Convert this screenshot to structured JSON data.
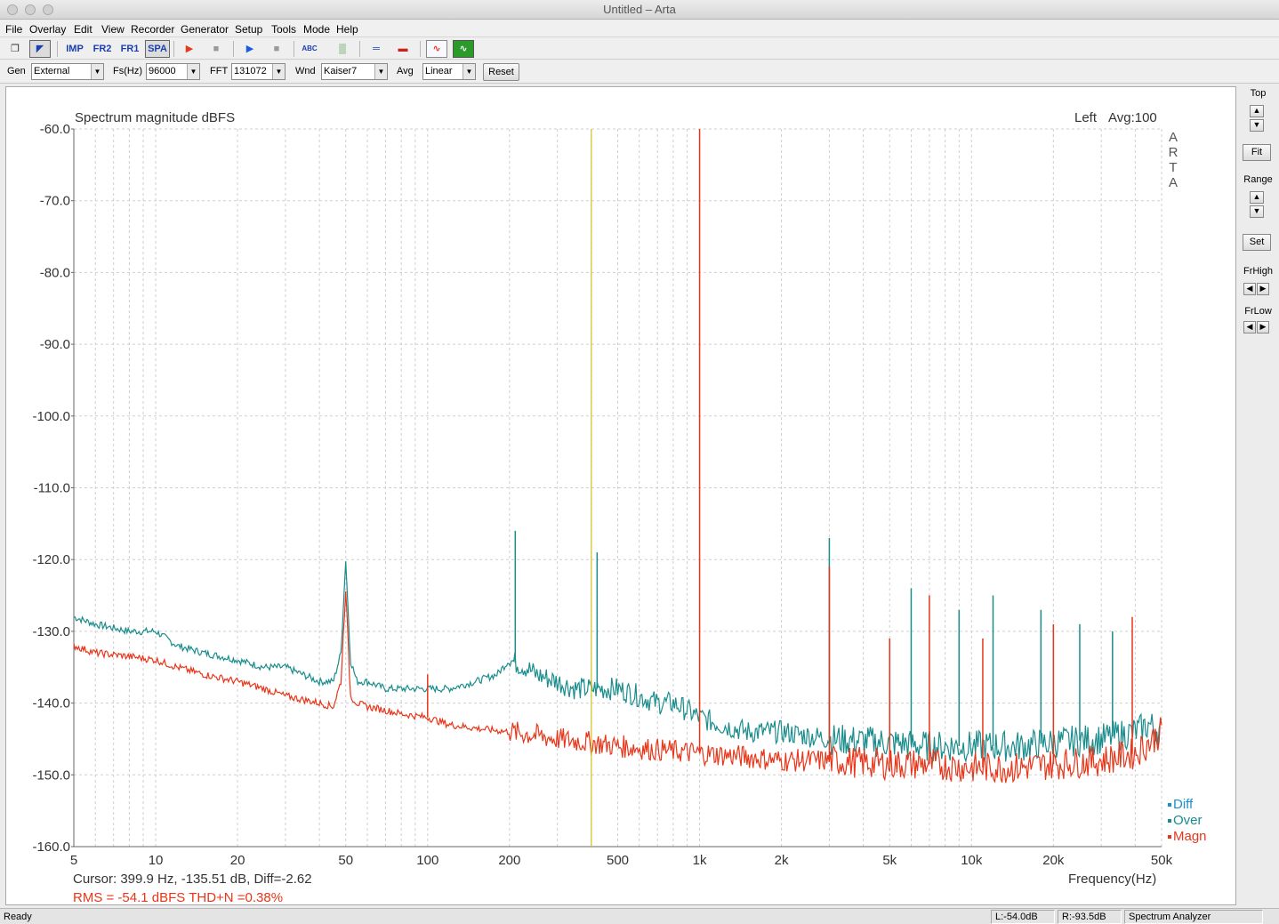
{
  "window": {
    "title": "Untitled – Arta"
  },
  "menu": [
    "File",
    "Overlay",
    "Edit",
    "View",
    "Recorder",
    "Generator",
    "Setup",
    "Tools",
    "Mode",
    "Help"
  ],
  "toolbar": {
    "buttons": [
      {
        "name": "new-icon",
        "label": "❐"
      },
      {
        "name": "open-icon",
        "label": "◤"
      },
      {
        "name": "imp-mode",
        "label": "IMP"
      },
      {
        "name": "fr2-mode",
        "label": "FR2"
      },
      {
        "name": "fr1-mode",
        "label": "FR1"
      },
      {
        "name": "spa-mode",
        "label": "SPA"
      },
      {
        "name": "record-play-icon",
        "label": "▶"
      },
      {
        "name": "record-stop-icon",
        "label": "■"
      },
      {
        "name": "gen-play-icon",
        "label": "▶"
      },
      {
        "name": "gen-stop-icon",
        "label": "■"
      },
      {
        "name": "abc-icon",
        "label": "ABC"
      },
      {
        "name": "overlay-icon",
        "label": "▒"
      },
      {
        "name": "probe-icon",
        "label": "═"
      },
      {
        "name": "meter-icon",
        "label": "▬"
      },
      {
        "name": "scope-icon",
        "label": "∿"
      },
      {
        "name": "generator-icon",
        "label": "∿"
      }
    ]
  },
  "controls": {
    "gen_label": "Gen",
    "gen_value": "External",
    "fs_label": "Fs(Hz)",
    "fs_value": "96000",
    "fft_label": "FFT",
    "fft_value": "131072",
    "wnd_label": "Wnd",
    "wnd_value": "Kaiser7",
    "avg_label": "Avg",
    "avg_value": "Linear",
    "reset_label": "Reset"
  },
  "chart_data": {
    "type": "line",
    "title": "Spectrum magnitude dBFS",
    "channel": "Left",
    "avg_label": "Avg:100",
    "watermark": [
      "A",
      "R",
      "T",
      "A"
    ],
    "xlabel": "Frequency(Hz)",
    "xscale": "log",
    "xlim": [
      5,
      50000
    ],
    "ylim": [
      -160,
      -60
    ],
    "x_ticks": [
      5,
      10,
      20,
      50,
      100,
      200,
      500,
      1000,
      2000,
      5000,
      10000,
      20000,
      50000
    ],
    "x_tick_labels": [
      "5",
      "10",
      "20",
      "50",
      "100",
      "200",
      "500",
      "1k",
      "2k",
      "5k",
      "10k",
      "20k",
      "50k"
    ],
    "y_ticks": [
      -60,
      -70,
      -80,
      -90,
      -100,
      -110,
      -120,
      -130,
      -140,
      -150,
      -160
    ],
    "y_tick_labels": [
      "-60.0",
      "-70.0",
      "-80.0",
      "-90.0",
      "-100.0",
      "-110.0",
      "-120.0",
      "-130.0",
      "-140.0",
      "-150.0",
      "-160.0"
    ],
    "grid": true,
    "cursor_x": 399.9,
    "cursor_text": "Cursor:   399.9 Hz, -135.51 dB,  Diff=-2.62",
    "rms_text": "RMS =  -54.1 dBFS   THD+N =0.38%",
    "legend_placement": "bottom-right",
    "legend": [
      {
        "name": "Diff",
        "color": "#1e90c8"
      },
      {
        "name": "Over",
        "color": "#1a8c8c"
      },
      {
        "name": "Magn",
        "color": "#e8361a"
      }
    ],
    "series": [
      {
        "name": "Over",
        "color": "#1a8c8c",
        "x": [
          5,
          6,
          8,
          10,
          12,
          15,
          20,
          25,
          30,
          40,
          45,
          48,
          50,
          52,
          55,
          60,
          70,
          80,
          100,
          120,
          150,
          180,
          200,
          230,
          250,
          300,
          350,
          400,
          500,
          600,
          700,
          800,
          900,
          1000,
          1200,
          1500,
          2000,
          3000,
          5000,
          7000,
          10000,
          15000,
          20000,
          30000,
          40000,
          45000,
          50000
        ],
        "y": [
          -128,
          -129,
          -130,
          -130,
          -132,
          -133,
          -134,
          -135,
          -135,
          -137,
          -137,
          -133,
          -120,
          -134,
          -137,
          -137,
          -138,
          -138,
          -138,
          -138,
          -137,
          -136,
          -134,
          -135,
          -136,
          -137,
          -138,
          -138,
          -138,
          -139,
          -140,
          -140,
          -141,
          -142,
          -143,
          -144,
          -144,
          -145,
          -145.5,
          -146,
          -146,
          -146,
          -145.5,
          -145,
          -144,
          -143,
          -144
        ]
      },
      {
        "name": "Magn",
        "color": "#e8361a",
        "x": [
          5,
          6,
          8,
          10,
          12,
          15,
          20,
          25,
          30,
          40,
          45,
          48,
          50,
          52,
          55,
          60,
          70,
          80,
          100,
          120,
          150,
          200,
          250,
          300,
          400,
          500,
          700,
          1000,
          1500,
          2000,
          3000,
          5000,
          7000,
          10000,
          15000,
          20000,
          30000,
          40000,
          45000,
          50000
        ],
        "y": [
          -132,
          -133,
          -133.5,
          -134,
          -135,
          -136,
          -137,
          -138,
          -139,
          -140,
          -140.5,
          -137,
          -124,
          -139,
          -140,
          -140.5,
          -141,
          -141.5,
          -142,
          -143,
          -143.5,
          -144,
          -144.5,
          -145,
          -145.5,
          -146,
          -146.5,
          -147,
          -147.5,
          -148,
          -148,
          -148.5,
          -148.5,
          -149,
          -149,
          -148.5,
          -148,
          -147,
          -145.5,
          -144
        ]
      }
    ],
    "spikes": [
      {
        "series": "Over",
        "x": 210,
        "y": -116
      },
      {
        "series": "Over",
        "x": 420,
        "y": -119
      },
      {
        "series": "Over",
        "x": 3000,
        "y": -117
      },
      {
        "series": "Over",
        "x": 6000,
        "y": -124
      },
      {
        "series": "Over",
        "x": 9000,
        "y": -127
      },
      {
        "series": "Over",
        "x": 12000,
        "y": -125
      },
      {
        "series": "Over",
        "x": 18000,
        "y": -127
      },
      {
        "series": "Over",
        "x": 25000,
        "y": -129
      },
      {
        "series": "Over",
        "x": 33000,
        "y": -130
      },
      {
        "series": "Magn",
        "x": 100,
        "y": -136
      },
      {
        "series": "Magn",
        "x": 1000,
        "y": -60
      },
      {
        "series": "Magn",
        "x": 3000,
        "y": -121
      },
      {
        "series": "Magn",
        "x": 5000,
        "y": -131
      },
      {
        "series": "Magn",
        "x": 7000,
        "y": -125
      },
      {
        "series": "Magn",
        "x": 11000,
        "y": -131
      },
      {
        "series": "Magn",
        "x": 20000,
        "y": -129
      },
      {
        "series": "Magn",
        "x": 39000,
        "y": -128
      }
    ]
  },
  "right_panel": {
    "top_label": "Top",
    "fit_label": "Fit",
    "range_label": "Range",
    "set_label": "Set",
    "frhigh_label": "FrHigh",
    "frlow_label": "FrLow"
  },
  "status": {
    "ready": "Ready",
    "left_level": "L:-54.0dB",
    "right_level": "R:-93.5dB",
    "mode": "Spectrum Analyzer"
  }
}
